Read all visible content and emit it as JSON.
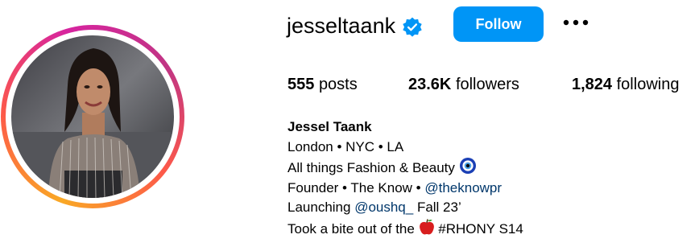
{
  "profile": {
    "username": "jesseltaank",
    "verified": true,
    "follow_label": "Follow",
    "avatar_description": "profile-photo",
    "stats": {
      "posts_count": "555",
      "posts_label": "posts",
      "followers_count": "23.6K",
      "followers_label": "followers",
      "following_count": "1,824",
      "following_label": "following"
    },
    "bio": {
      "name": "Jessel Taank",
      "line1": "London • NYC • LA",
      "line2": "All things Fashion & Beauty",
      "line2_icon": "nazar-evil-eye-icon",
      "line3_prefix": "Founder • The Know • ",
      "line3_link": "@theknowpr",
      "line4_prefix": "Launching ",
      "line4_link": "@oushq_",
      "line4_suffix": " Fall 23’",
      "line5_prefix": "Took a bite out of the",
      "line5_icon": "apple-icon",
      "line5_suffix": " #RHONY S14"
    }
  },
  "colors": {
    "accent": "#0095f6",
    "link": "#00376b",
    "verified_badge": "#0095f6"
  },
  "icons": [
    "verified-badge-icon",
    "more-options-icon",
    "nazar-evil-eye-icon",
    "apple-icon"
  ]
}
